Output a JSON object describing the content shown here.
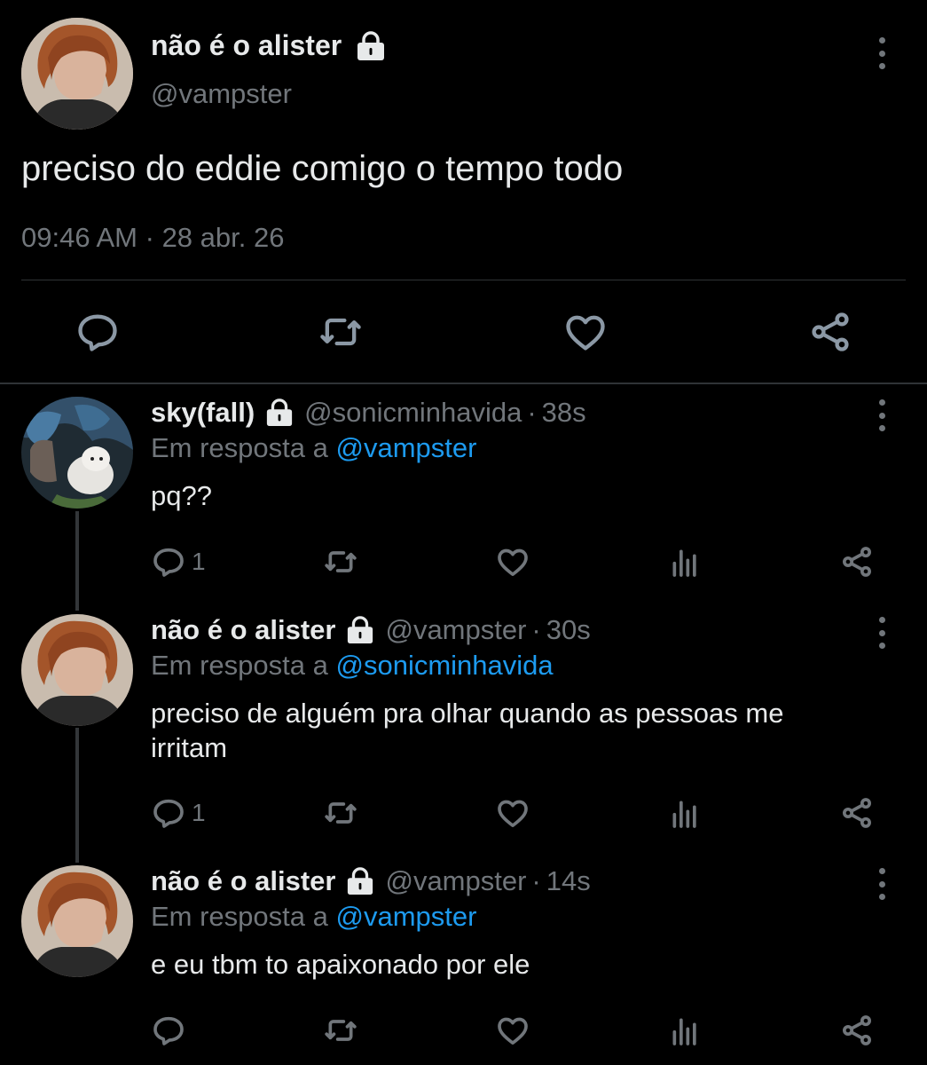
{
  "main_tweet": {
    "author_name": "não é o alister",
    "handle": "@vampster",
    "text": "preciso do eddie comigo o tempo todo",
    "time": "09:46 AM",
    "separator": "·",
    "date": "28 abr. 26",
    "actions": [
      "reply-icon",
      "retweet-icon",
      "like-icon",
      "share-icon"
    ]
  },
  "replies": [
    {
      "author_name": "sky(fall)",
      "handle": "@sonicminhavida",
      "separator": "·",
      "time": "38s",
      "in_reply_prefix": "Em resposta a",
      "in_reply_mention": "@vampster",
      "text": "pq??",
      "reply_count": "1"
    },
    {
      "author_name": "não é o alister",
      "handle": "@vampster",
      "separator": "·",
      "time": "30s",
      "in_reply_prefix": "Em resposta a",
      "in_reply_mention": "@sonicminhavida",
      "text": "preciso de alguém pra olhar quando as pessoas me irritam",
      "reply_count": "1"
    },
    {
      "author_name": "não é o alister",
      "handle": "@vampster",
      "separator": "·",
      "time": "14s",
      "in_reply_prefix": "Em resposta a",
      "in_reply_mention": "@vampster",
      "text": "e eu tbm to apaixonado por ele",
      "reply_count": ""
    }
  ],
  "colors": {
    "background": "#000000",
    "text": "#e7e9ea",
    "muted": "#71767b",
    "link": "#1d9bf0",
    "divider": "#2f3336"
  }
}
